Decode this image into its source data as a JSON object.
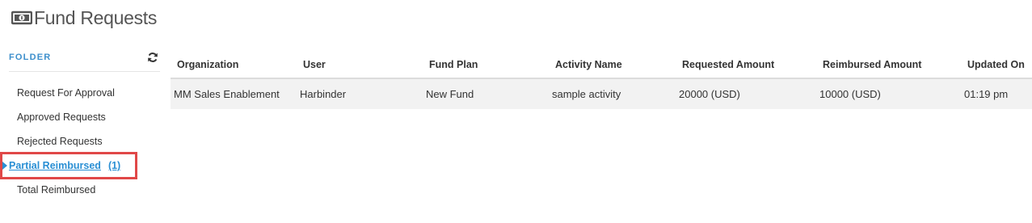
{
  "header": {
    "title": "Fund Requests",
    "icon": "money-icon"
  },
  "sidebar": {
    "folder_label": "FOLDER",
    "refresh_icon": "refresh-icon",
    "items": [
      {
        "label": "Request For Approval"
      },
      {
        "label": "Approved Requests"
      },
      {
        "label": "Rejected Requests"
      },
      {
        "label": "Partial Reimbursed",
        "count": "(1)",
        "active": true
      },
      {
        "label": "Total Reimbursed"
      }
    ]
  },
  "table": {
    "columns": [
      "Organization",
      "User",
      "Fund Plan",
      "Activity Name",
      "Requested Amount",
      "Reimbursed Amount",
      "Updated On"
    ],
    "rows": [
      [
        "MM Sales Enablement",
        "Harbinder",
        "New Fund",
        "sample activity",
        "20000 (USD)",
        "10000 (USD)",
        "01:19 pm"
      ]
    ]
  },
  "colors": {
    "accent": "#2a8fd4",
    "highlight_border": "#e04848"
  }
}
